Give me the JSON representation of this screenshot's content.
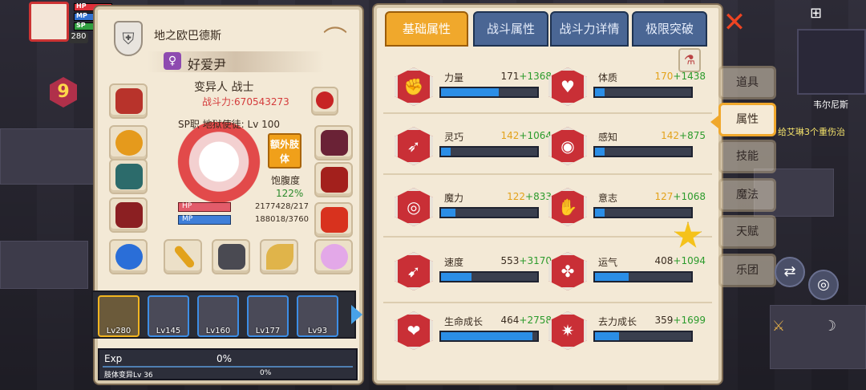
{
  "hud": {
    "level_small": "280",
    "hp_label": "HP",
    "mp_label": "MP",
    "sp_label": "SP",
    "top_value": "2177428",
    "floor_badge": "9"
  },
  "char": {
    "guild": "地之欧巴德斯",
    "name": "好爱尹",
    "gender_symbol": "♀",
    "class": "变异人 战士",
    "power": "战斗力:670543273",
    "job": "SP职 地狱使徒: Lv 100",
    "extra_limb": "额外肢体",
    "satiety_label": "饱腹度",
    "satiety_value": "122%",
    "hp_label": "HP",
    "mp_label": "MP",
    "hp_value": "2177428/217",
    "mp_value": "188018/3760"
  },
  "party": [
    {
      "level": "Lv280",
      "selected": true
    },
    {
      "level": "Lv145",
      "selected": false
    },
    {
      "level": "Lv160",
      "selected": false
    },
    {
      "level": "Lv177",
      "selected": false
    },
    {
      "level": "Lv93",
      "selected": false
    }
  ],
  "exp": {
    "label": "Exp",
    "percent": "0%",
    "mutation_label": "肢体变异Lv 36",
    "mutation_percent": "0%"
  },
  "tabs": [
    "基础属性",
    "战斗属性",
    "战斗力详情",
    "极限突破"
  ],
  "stats": [
    {
      "name": "力量",
      "base": "171",
      "bonus": "+1368",
      "fill": 0.6,
      "icon": "arm-icon",
      "gold": false
    },
    {
      "name": "体质",
      "base": "170",
      "bonus": "+1438",
      "fill": 0.1,
      "icon": "body-icon",
      "gold": true
    },
    {
      "name": "灵巧",
      "base": "142",
      "bonus": "+1064",
      "fill": 0.1,
      "icon": "runner-icon",
      "gold": true
    },
    {
      "name": "感知",
      "base": "142",
      "bonus": "+875",
      "fill": 0.1,
      "icon": "eye-icon",
      "gold": true
    },
    {
      "name": "魔力",
      "base": "122",
      "bonus": "+833",
      "fill": 0.15,
      "icon": "swirl-icon",
      "gold": true
    },
    {
      "name": "意志",
      "base": "127",
      "bonus": "+1068",
      "fill": 0.1,
      "icon": "will-icon",
      "gold": true
    },
    {
      "name": "速度",
      "base": "553",
      "bonus": "+3170",
      "fill": 0.32,
      "icon": "speed-icon",
      "gold": false
    },
    {
      "name": "运气",
      "base": "408",
      "bonus": "+1094",
      "fill": 0.35,
      "icon": "clover-icon",
      "gold": false
    },
    {
      "name": "生命成长",
      "base": "464",
      "bonus": "+2758",
      "fill": 0.95,
      "icon": "heart-icon",
      "gold": false
    },
    {
      "name": "去力成长",
      "base": "359",
      "bonus": "+1699",
      "fill": 0.25,
      "icon": "star-growth-icon",
      "gold": false
    }
  ],
  "side_menu": [
    "道具",
    "属性",
    "技能",
    "魔法",
    "天赋",
    "乐团"
  ],
  "world": {
    "map_name": "韦尔尼斯",
    "log": "给艾琳3个重伤治"
  }
}
